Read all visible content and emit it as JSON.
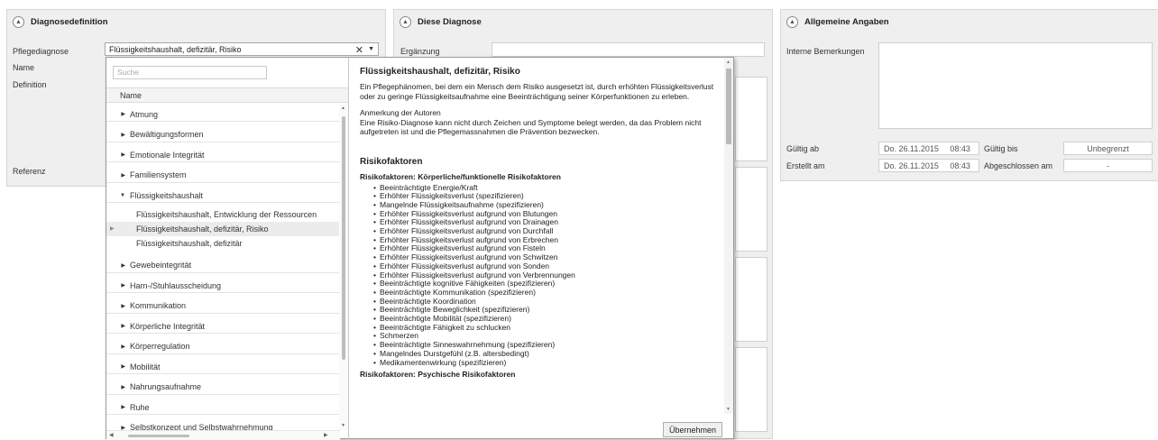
{
  "panel_diagnose_def": {
    "title": "Diagnosedefinition",
    "pflegediagnose_label": "Pflegediagnose",
    "pflegediagnose_value": "Flüssigkeitshaushalt, defizitär, Risiko",
    "name_label": "Name",
    "definition_label": "Definition",
    "referenz_label": "Referenz"
  },
  "panel_diese_diagnose": {
    "title": "Diese Diagnose",
    "ergaenzung_label": "Ergänzung"
  },
  "panel_allgemein": {
    "title": "Allgemeine Angaben",
    "interne_label": "Interne Bemerkungen",
    "gueltig_ab_label": "Gültig ab",
    "gueltig_ab_value": "Do. 26.11.2015     08:43",
    "gueltig_bis_label": "Gültig bis",
    "gueltig_bis_value": "Unbegrenzt",
    "erstellt_label": "Erstellt am",
    "erstellt_value": "Do. 26.11.2015     08:43",
    "abgeschlossen_label": "Abgeschlossen am",
    "abgeschlossen_value": "-"
  },
  "popup": {
    "search_placeholder": "Suche",
    "column_name": "Name",
    "tree": [
      {
        "label": "Atmung",
        "kind": "cat"
      },
      {
        "label": "Bewältigungsformen",
        "kind": "cat"
      },
      {
        "label": "Emotionale Integrität",
        "kind": "cat"
      },
      {
        "label": "Familiensystem",
        "kind": "cat"
      },
      {
        "label": "Flüssigkeitshaushalt",
        "kind": "open"
      },
      {
        "label": "Flüssigkeitshaushalt, Entwicklung der Ressourcen",
        "kind": "child"
      },
      {
        "label": "Flüssigkeitshaushalt, defizitär, Risiko",
        "kind": "child-sel"
      },
      {
        "label": "Flüssigkeitshaushalt, defizitär",
        "kind": "child"
      },
      {
        "label": "Gewebeintegrität",
        "kind": "cat"
      },
      {
        "label": "Harn-/Stuhlausscheidung",
        "kind": "cat"
      },
      {
        "label": "Kommunikation",
        "kind": "cat"
      },
      {
        "label": "Körperliche Integrität",
        "kind": "cat"
      },
      {
        "label": "Körperregulation",
        "kind": "cat"
      },
      {
        "label": "Mobilität",
        "kind": "cat"
      },
      {
        "label": "Nahrungsaufnahme",
        "kind": "cat"
      },
      {
        "label": "Ruhe",
        "kind": "cat"
      },
      {
        "label": "Selbstkonzept und Selbstwahrnehmung",
        "kind": "cat"
      }
    ],
    "detail": {
      "title": "Flüssigkeitshaushalt, defizitär, Risiko",
      "description": "Ein Pflegephänomen, bei dem ein Mensch dem Risiko ausgesetzt ist, durch erhöhten Flüssigkeitsverlust oder zu geringe Flüssigkeitsaufnahme eine Beeinträchtigung seiner Körperfunktionen zu erleben.",
      "note_heading": "Anmerkung der Autoren",
      "note_text": "Eine Risiko-Diagnose kann nicht durch Zeichen und Symptome belegt werden, da das Problem nicht aufgetreten ist und die Pflegemassnahmen die Prävention bezwecken.",
      "risk_heading": "Risikofaktoren",
      "risk_sub1": "Risikofaktoren: Körperliche/funktionelle Risikofaktoren",
      "risk_items": [
        "Beeinträchtigte Energie/Kraft",
        "Erhöhter Flüssigkeitsverlust (spezifizieren)",
        "Mangelnde Flüssigkeitsaufnahme (spezifizieren)",
        "Erhöhter Flüssigkeitsverlust aufgrund von Blutungen",
        "Erhöhter Flüssigkeitsverlust aufgrund von Drainagen",
        "Erhöhter Flüssigkeitsverlust aufgrund von Durchfall",
        "Erhöhter Flüssigkeitsverlust aufgrund von Erbrechen",
        "Erhöhter Flüssigkeitsverlust aufgrund von Fisteln",
        "Erhöhter Flüssigkeitsverlust aufgrund von Schwitzen",
        "Erhöhter Flüssigkeitsverlust aufgrund von Sonden",
        "Erhöhter Flüssigkeitsverlust aufgrund von Verbrennungen",
        "Beeinträchtigte kognitive Fähigkeiten (spezifizieren)",
        "Beeinträchtigte Kommunikation (spezifizieren)",
        "Beeinträchtigte Koordination",
        "Beeinträchtigte Beweglichkeit (spezifizieren)",
        "Beeinträchtigte Mobilität (spezifizieren)",
        "Beeinträchtigte Fähigkeit zu schlucken",
        "Schmerzen",
        "Beeinträchtigte Sinneswahrnehmung (spezifizieren)",
        "Mangelndes Durstgefühl (z.B. altersbedingt)",
        "Medikamentenwirkung (spezifizieren)"
      ],
      "risk_sub2": "Risikofaktoren: Psychische Risikofaktoren"
    },
    "apply_label": "Übernehmen"
  }
}
